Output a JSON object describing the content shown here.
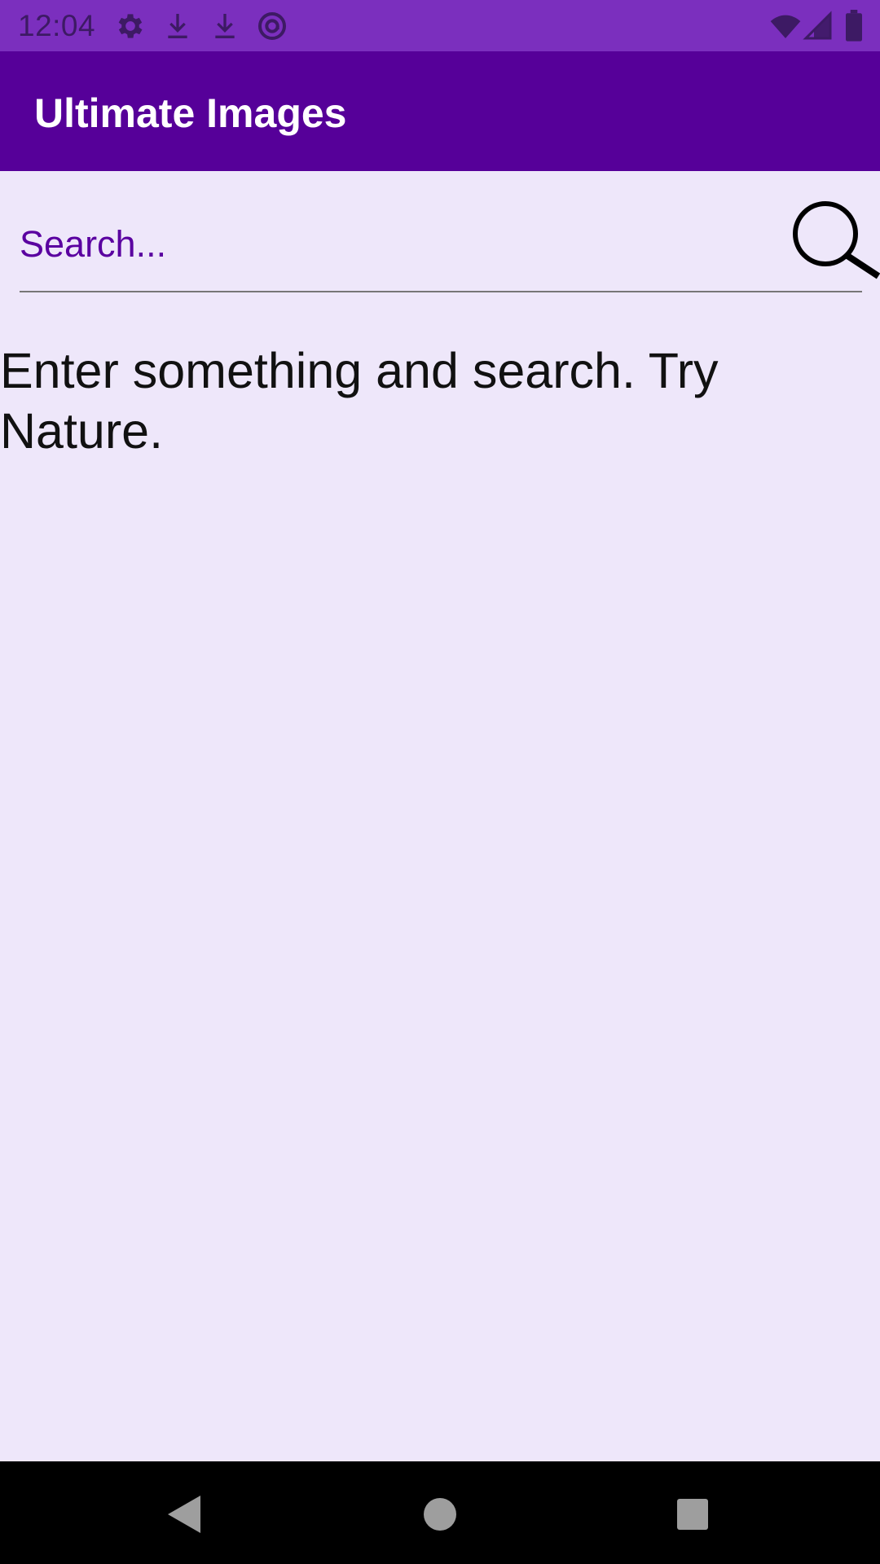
{
  "status_bar": {
    "time": "12:04",
    "left_icons": [
      "gear-icon",
      "download-icon",
      "download-icon",
      "at-sign-icon"
    ],
    "right_icons": [
      "wifi-icon",
      "cell-signal-icon",
      "battery-icon"
    ],
    "color": "#7B2FBE"
  },
  "app_bar": {
    "title": "Ultimate Images",
    "color": "#560099"
  },
  "search": {
    "placeholder": "Search...",
    "value": "",
    "button_icon": "search-icon"
  },
  "main": {
    "hint": "Enter something and search. Try Nature."
  },
  "nav_bar": {
    "buttons": [
      "back-icon",
      "home-icon",
      "recents-icon"
    ]
  },
  "colors": {
    "background": "#EEE7FA",
    "accent": "#560099",
    "status_bar": "#7B2FBE"
  }
}
